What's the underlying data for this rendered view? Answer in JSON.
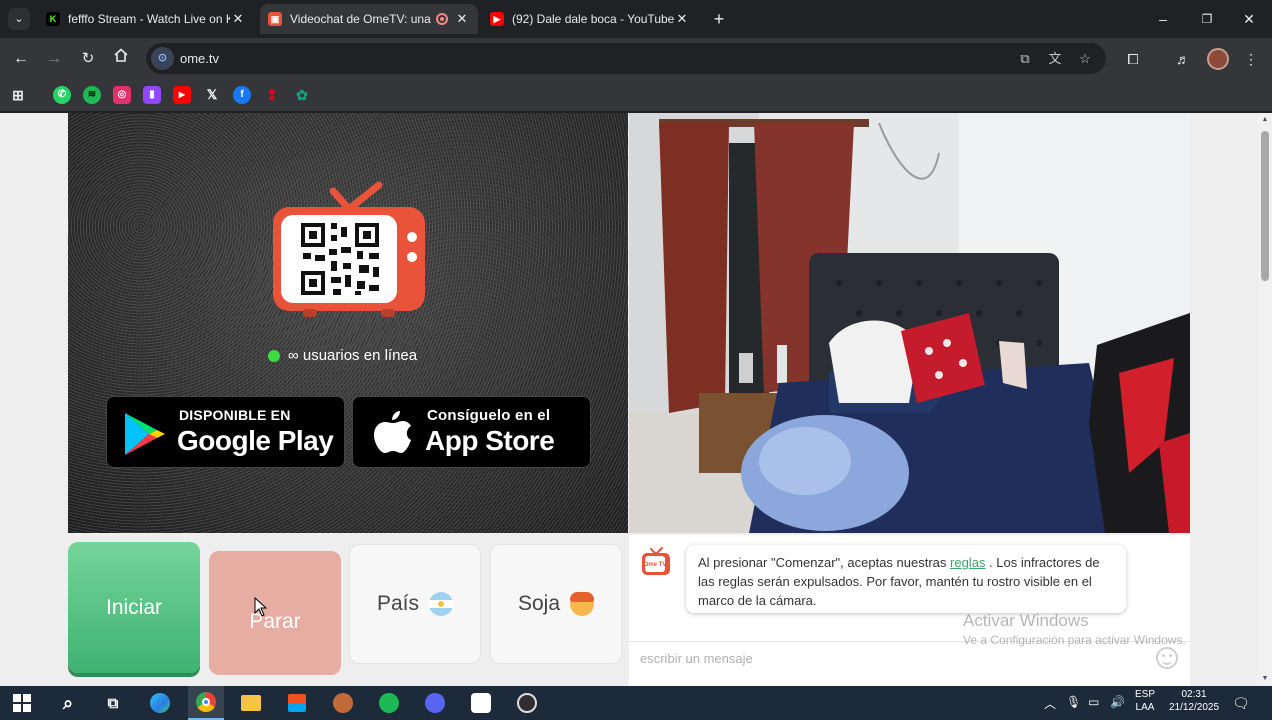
{
  "browser": {
    "tabs": [
      {
        "title": "fefffo Stream - Watch Live on K",
        "icon": "kick-icon",
        "color": "#53fc18",
        "active": false
      },
      {
        "title": "Videochat de OmeTV: una",
        "icon": "ometv-icon",
        "color": "#e8533a",
        "active": true,
        "recording": true
      },
      {
        "title": "(92) Dale dale boca - YouTube",
        "icon": "youtube-icon",
        "color": "#ff0000",
        "active": false
      }
    ],
    "new_tab_symbol": "+",
    "window_controls": {
      "minimize": "–",
      "maximize": "❐",
      "close": "✕"
    },
    "url": "ome.tv",
    "bookmarks": [
      {
        "name": "apps-grid-icon",
        "color": "#e8eaed"
      },
      {
        "name": "whatsapp-icon",
        "color": "#25d366"
      },
      {
        "name": "spotify-icon",
        "color": "#1db954"
      },
      {
        "name": "instagram-icon",
        "color": "#e1306c"
      },
      {
        "name": "twitch-icon",
        "color": "#9146ff"
      },
      {
        "name": "youtube-icon",
        "color": "#ff0000"
      },
      {
        "name": "x-icon",
        "color": "#ffffff"
      },
      {
        "name": "facebook-icon",
        "color": "#1877f2"
      },
      {
        "name": "pinterest-icon",
        "color": "#e60023"
      },
      {
        "name": "chatgpt-icon",
        "color": "#10a37f"
      }
    ]
  },
  "page": {
    "online_text": "∞ usuarios en línea",
    "google_play": {
      "small": "DISPONIBLE EN",
      "big": "Google Play"
    },
    "app_store": {
      "small": "Consíguelo en el",
      "big": "App Store"
    },
    "buttons": {
      "start": "Iniciar",
      "stop": "Parar",
      "country": "País",
      "gender": "Soja"
    },
    "chat": {
      "logo_text": "Ome TV",
      "notice_before_link": "Al presionar \"Comenzar\", aceptas nuestras ",
      "notice_link": "reglas",
      "notice_after_link": " . Los infractores de las reglas serán expulsados. Por favor, mantén tu rostro visible en el marco de la cámara.",
      "input_placeholder": "escribir un mensaje"
    },
    "watermark": {
      "title": "Activar Windows",
      "subtitle": "Ve a Configuración para activar Windows."
    },
    "colors": {
      "start": "#4cbb7f",
      "stop": "#e7aca2",
      "online_dot": "#3ddc40",
      "link": "#3fa36f"
    }
  },
  "taskbar": {
    "apps": [
      "windows-start-icon",
      "search-icon",
      "task-view-icon",
      "edge-icon",
      "chrome-icon",
      "file-explorer-icon",
      "microsoft-store-icon",
      "app-icon",
      "spotify-icon",
      "discord-icon",
      "capcut-icon",
      "obs-icon"
    ],
    "lang_top": "ESP",
    "lang_bottom": "LAA",
    "time": "02:31",
    "date": "21/12/2025"
  }
}
